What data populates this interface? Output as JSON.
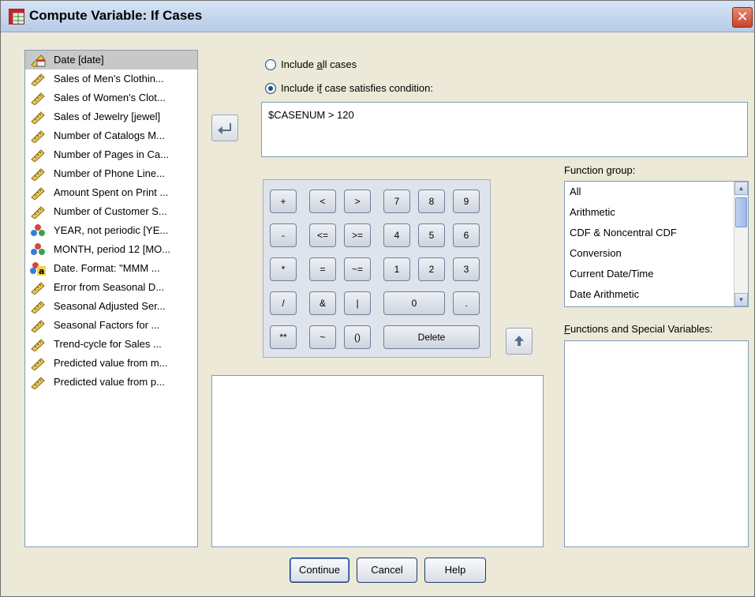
{
  "window": {
    "title": "Compute Variable: If Cases",
    "close_glyph": "✕"
  },
  "variables": [
    {
      "label": "Date [date]",
      "icon": "date-ruler-icon",
      "selected": true
    },
    {
      "label": "Sales of Men's Clothin...",
      "icon": "ruler-icon"
    },
    {
      "label": "Sales of Women's Clot...",
      "icon": "ruler-icon"
    },
    {
      "label": "Sales of Jewelry [jewel]",
      "icon": "ruler-icon"
    },
    {
      "label": "Number of Catalogs M...",
      "icon": "ruler-icon"
    },
    {
      "label": "Number of Pages in Ca...",
      "icon": "ruler-icon"
    },
    {
      "label": "Number of Phone Line...",
      "icon": "ruler-icon"
    },
    {
      "label": "Amount Spent on Print ...",
      "icon": "ruler-icon"
    },
    {
      "label": "Number of Customer S...",
      "icon": "ruler-icon"
    },
    {
      "label": "YEAR, not periodic [YE...",
      "icon": "nominal-circles-icon"
    },
    {
      "label": "MONTH, period 12 [MO...",
      "icon": "nominal-circles-icon"
    },
    {
      "label": "Date. Format: \"MMM ...",
      "icon": "string-nominal-icon"
    },
    {
      "label": "Error from Seasonal D...",
      "icon": "ruler-icon"
    },
    {
      "label": "Seasonal Adjusted Ser...",
      "icon": "ruler-icon"
    },
    {
      "label": "Seasonal Factors for ...",
      "icon": "ruler-icon"
    },
    {
      "label": "Trend-cycle for Sales ...",
      "icon": "ruler-icon"
    },
    {
      "label": "Predicted value from m...",
      "icon": "ruler-icon"
    },
    {
      "label": "Predicted value from p...",
      "icon": "ruler-icon"
    }
  ],
  "options": {
    "include_all": {
      "pre": "Include ",
      "accel": "a",
      "post": "ll cases"
    },
    "include_if": {
      "pre": "Include i",
      "accel": "f",
      "post": " case satisfies condition:"
    },
    "selected": "include_if"
  },
  "expression": "$CASENUM > 120",
  "keypad": {
    "keys": [
      "+",
      "<",
      ">",
      "7",
      "8",
      "9",
      "-",
      "<=",
      ">=",
      "4",
      "5",
      "6",
      "*",
      "=",
      "~=",
      "1",
      "2",
      "3",
      "/",
      "&",
      "|",
      "0",
      ".",
      "**",
      "~",
      "()",
      "Delete"
    ]
  },
  "function_group": {
    "label_pre": "Function ",
    "label_accel": "g",
    "label_post": "roup:",
    "items": [
      "All",
      "Arithmetic",
      "CDF & Noncentral CDF",
      "Conversion",
      "Current Date/Time",
      "Date Arithmetic"
    ]
  },
  "functions_special": {
    "label_accel": "F",
    "label_post": "unctions and Special Variables:"
  },
  "buttons": {
    "continue": "Continue",
    "cancel": "Cancel",
    "help": "Help"
  }
}
